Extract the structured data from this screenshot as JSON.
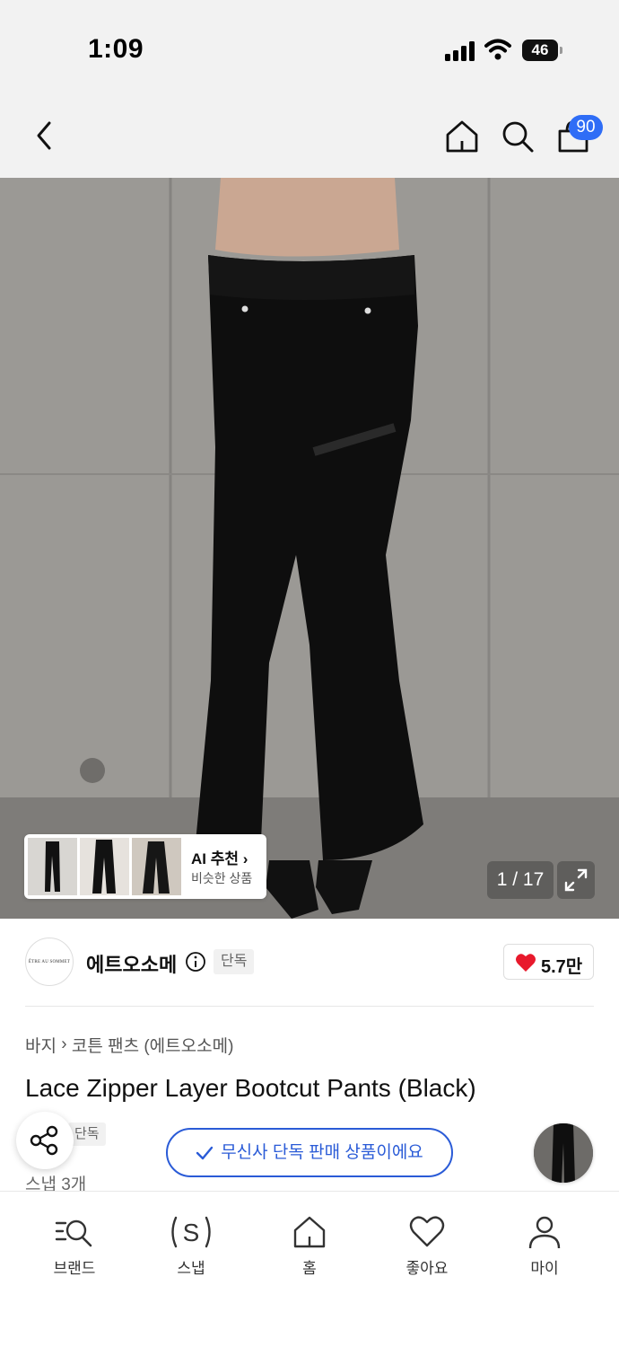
{
  "status_bar": {
    "time": "1:09",
    "battery": "46"
  },
  "header": {
    "cart_count": "90"
  },
  "gallery": {
    "counter": "1 / 17",
    "ai_recommend": {
      "title": "AI 추천 ",
      "subtitle": "비슷한 상품"
    }
  },
  "brand": {
    "name": "에트오소메",
    "logo_text": "ÊTRE AU SOMMET",
    "tag": "단독",
    "likes": "5.7만"
  },
  "product": {
    "breadcrumb": [
      "바지",
      "코튼 팬츠 (에트오소메)"
    ],
    "title": "Lace Zipper Layer Bootcut Pants (Black)",
    "tag": "단독",
    "snap_count": "스냅 3개"
  },
  "toast": {
    "text": "무신사 단독 판매 상품이에요"
  },
  "bottom_nav": {
    "tabs": [
      {
        "label": "브랜드",
        "icon": "brand-search-icon"
      },
      {
        "label": "스냅",
        "icon": "snap-icon"
      },
      {
        "label": "홈",
        "icon": "home-icon"
      },
      {
        "label": "좋아요",
        "icon": "heart-icon"
      },
      {
        "label": "마이",
        "icon": "user-icon"
      }
    ]
  },
  "colors": {
    "accent": "#2a5bd7",
    "badge": "#2f6df6",
    "heart": "#e8192c"
  }
}
